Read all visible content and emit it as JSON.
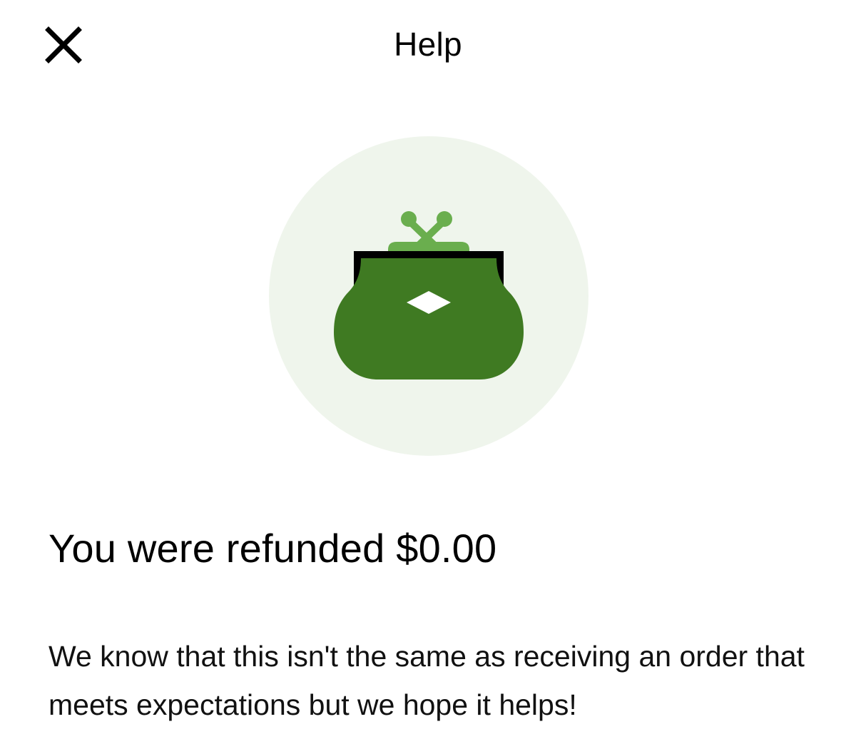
{
  "header": {
    "title": "Help",
    "close_icon": "close-icon"
  },
  "illustration": {
    "icon": "coin-purse-icon",
    "colors": {
      "circle_background": "#EFF5EC",
      "purse_body": "#3F7A22",
      "clasp": "#6AAE4E",
      "frame": "#000000",
      "emblem": "#FFFFFF"
    }
  },
  "refund": {
    "title": "You were refunded $0.00",
    "message": "We know that this isn't the same as receiving an order that meets expectations but we hope it helps!"
  }
}
